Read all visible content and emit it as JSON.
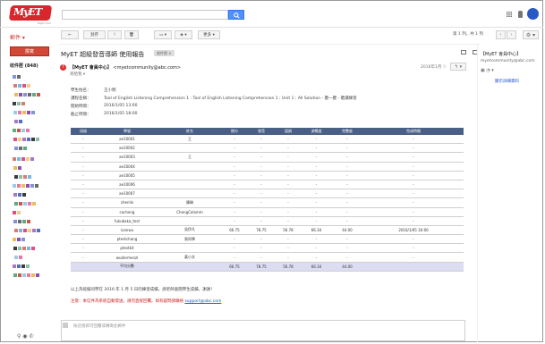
{
  "header": {
    "logo_text": "MyET",
    "logo_sub": "MyET.com",
    "apps_icon": "grid-icon",
    "notif_icon": "bell-icon",
    "avatar_icon": "account-avatar"
  },
  "nav": {
    "brand_menu": "郵件 ▾",
    "compose_label": "撰寫",
    "inbox_label": "收件匣 (848)"
  },
  "toolbar": {
    "back": "←",
    "archive": "封存",
    "spam": "!",
    "delete": "🗑",
    "move": "▭ ▾",
    "label": "◈ ▾",
    "more": "更多 ▾",
    "pager": "第 1 列，共 1 列",
    "prev": "‹",
    "next": "›",
    "settings": "⚙ ▾"
  },
  "subject": {
    "title": "MyET 超級發音導師 使用報告",
    "tag": "收件匣 ×"
  },
  "message": {
    "sender_name": "【MyET 會員中心】",
    "sender_email": "<myetcommunity@abc.com>",
    "recipient": "寄給我 ▾",
    "date": "2016年1月",
    "star": "☆",
    "reply": "↰ ▾"
  },
  "meta": [
    {
      "label": "學生姓名：",
      "value": "王小明"
    },
    {
      "label": "課程名稱：",
      "value": "Tool of English Listening Comprehension 1 : Tool of English Listening Comprehension 1 : Unit 1 : All Solution - 聽一聽 - 聽讀練習"
    },
    {
      "label": "開始時間：",
      "value": "2016/1/05 13:00"
    },
    {
      "label": "截止時間：",
      "value": "2016/1/05 18:00"
    }
  ],
  "table": {
    "headers": [
      "班級",
      "學號",
      "姓名",
      "總分",
      "發音",
      "語調",
      "流暢度",
      "完整度",
      "完成時間"
    ],
    "rows": [
      [
        "-",
        "ae10001",
        "王",
        "-",
        "-",
        "-",
        "-",
        "-",
        "-"
      ],
      [
        "-",
        "ae10002",
        "",
        "-",
        "-",
        "-",
        "-",
        "-",
        "-"
      ],
      [
        "-",
        "ae10003",
        "王",
        "-",
        "-",
        "-",
        "-",
        "-",
        "-"
      ],
      [
        "-",
        "ae10004",
        "",
        "-",
        "-",
        "-",
        "-",
        "-",
        "-"
      ],
      [
        "-",
        "ae10005",
        "",
        "-",
        "-",
        "-",
        "-",
        "-",
        "-"
      ],
      [
        "-",
        "ae10006",
        "",
        "-",
        "-",
        "-",
        "-",
        "-",
        "-"
      ],
      [
        "-",
        "ae10007",
        "",
        "-",
        "-",
        "-",
        "-",
        "-",
        "-"
      ],
      [
        "-",
        "chenlin",
        "陳琳",
        "-",
        "-",
        "-",
        "-",
        "-",
        "-"
      ],
      [
        "-",
        "cocheng",
        "ChengColomm",
        "-",
        "-",
        "-",
        "-",
        "-",
        "-"
      ],
      [
        "-",
        "fukubaka_test",
        "",
        "-",
        "-",
        "-",
        "-",
        "-",
        "-"
      ],
      [
        "-",
        "ivanwu",
        "吳伊凡",
        "66.75",
        "78.75",
        "56.78",
        "66.34",
        "44.00",
        "2016/1/05 16:00"
      ],
      [
        "-",
        "ptestchang",
        "張同學",
        "-",
        "-",
        "-",
        "-",
        "-",
        "-"
      ],
      [
        "-",
        "ptestkit",
        "",
        "-",
        "-",
        "-",
        "-",
        "-",
        "-"
      ],
      [
        "-",
        "wudermenzl",
        "黃小文",
        "-",
        "-",
        "-",
        "-",
        "-",
        "-"
      ]
    ],
    "total": [
      "",
      "平均分數",
      "",
      "66.75",
      "78.75",
      "56.78",
      "66.34",
      "44.00",
      ""
    ]
  },
  "footer": {
    "note": "以上為班級同學在 2016 年 1 月 5 日的練習成績，請老師查閱學生成績，謝謝！",
    "warning": "注意：本信件為系統自動發送，請勿直接回覆。如有疑問請聯絡",
    "warning_link": "support@abc.com",
    "reply_placeholder": "按這裡即可回覆或轉寄此郵件"
  },
  "right_panel": {
    "name": "【MyET 會員中心】",
    "email": "myetcommunity@abc.com",
    "icons": "▣ ◔ ▾",
    "link": "顯示詳細資料"
  },
  "colors": {
    "accent": "#d14836",
    "table_header": "#4a5f86",
    "total_row": "#dcdcf2",
    "search_button": "#4d90fe"
  }
}
